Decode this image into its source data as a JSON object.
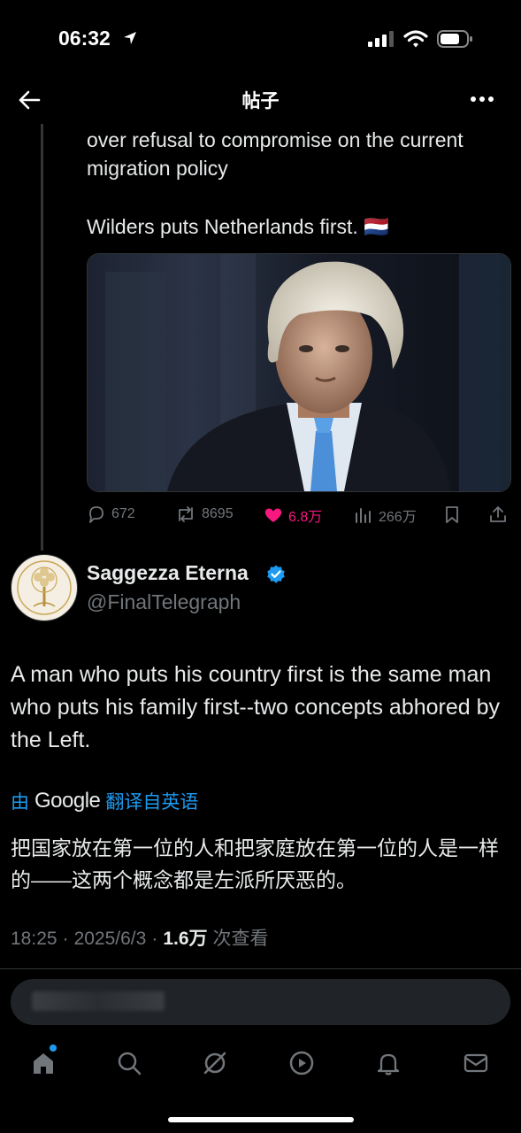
{
  "status_bar": {
    "time": "06:32"
  },
  "header": {
    "title": "帖子"
  },
  "quoted_post": {
    "line1": "over refusal to compromise on the current",
    "line2": "migration policy",
    "line3": "Wilders puts Netherlands first. 🇳🇱",
    "actions": {
      "replies": "672",
      "reposts": "8695",
      "likes": "6.8万",
      "views": "266万"
    }
  },
  "post": {
    "author_name": "Saggezza Eterna",
    "author_handle": "@FinalTelegraph",
    "text": "A man who puts his country first is the same man who puts his family first--two concepts abhored by the Left.",
    "translate_prefix": "由",
    "translate_brand": "Google",
    "translate_suffix": "翻译自英语",
    "translated_text": "把国家放在第一位的人和把家庭放在第一位的人是一样的——这两个概念都是左派所厌恶的。",
    "time": "18:25",
    "date": "2025/6/3",
    "views_count": "1.6万",
    "views_label": "次查看"
  },
  "colors": {
    "accent": "#1d9bf0",
    "like": "#f91880",
    "muted": "#71767b",
    "background": "#000000"
  },
  "icons": [
    "location-arrow-icon",
    "signal-icon",
    "wifi-icon",
    "battery-icon",
    "back-arrow-icon",
    "more-icon",
    "reply-icon",
    "repost-icon",
    "heart-icon",
    "views-icon",
    "bookmark-icon",
    "share-icon",
    "verified-icon",
    "home-icon",
    "search-icon",
    "grok-icon",
    "video-icon",
    "notifications-icon",
    "messages-icon"
  ]
}
